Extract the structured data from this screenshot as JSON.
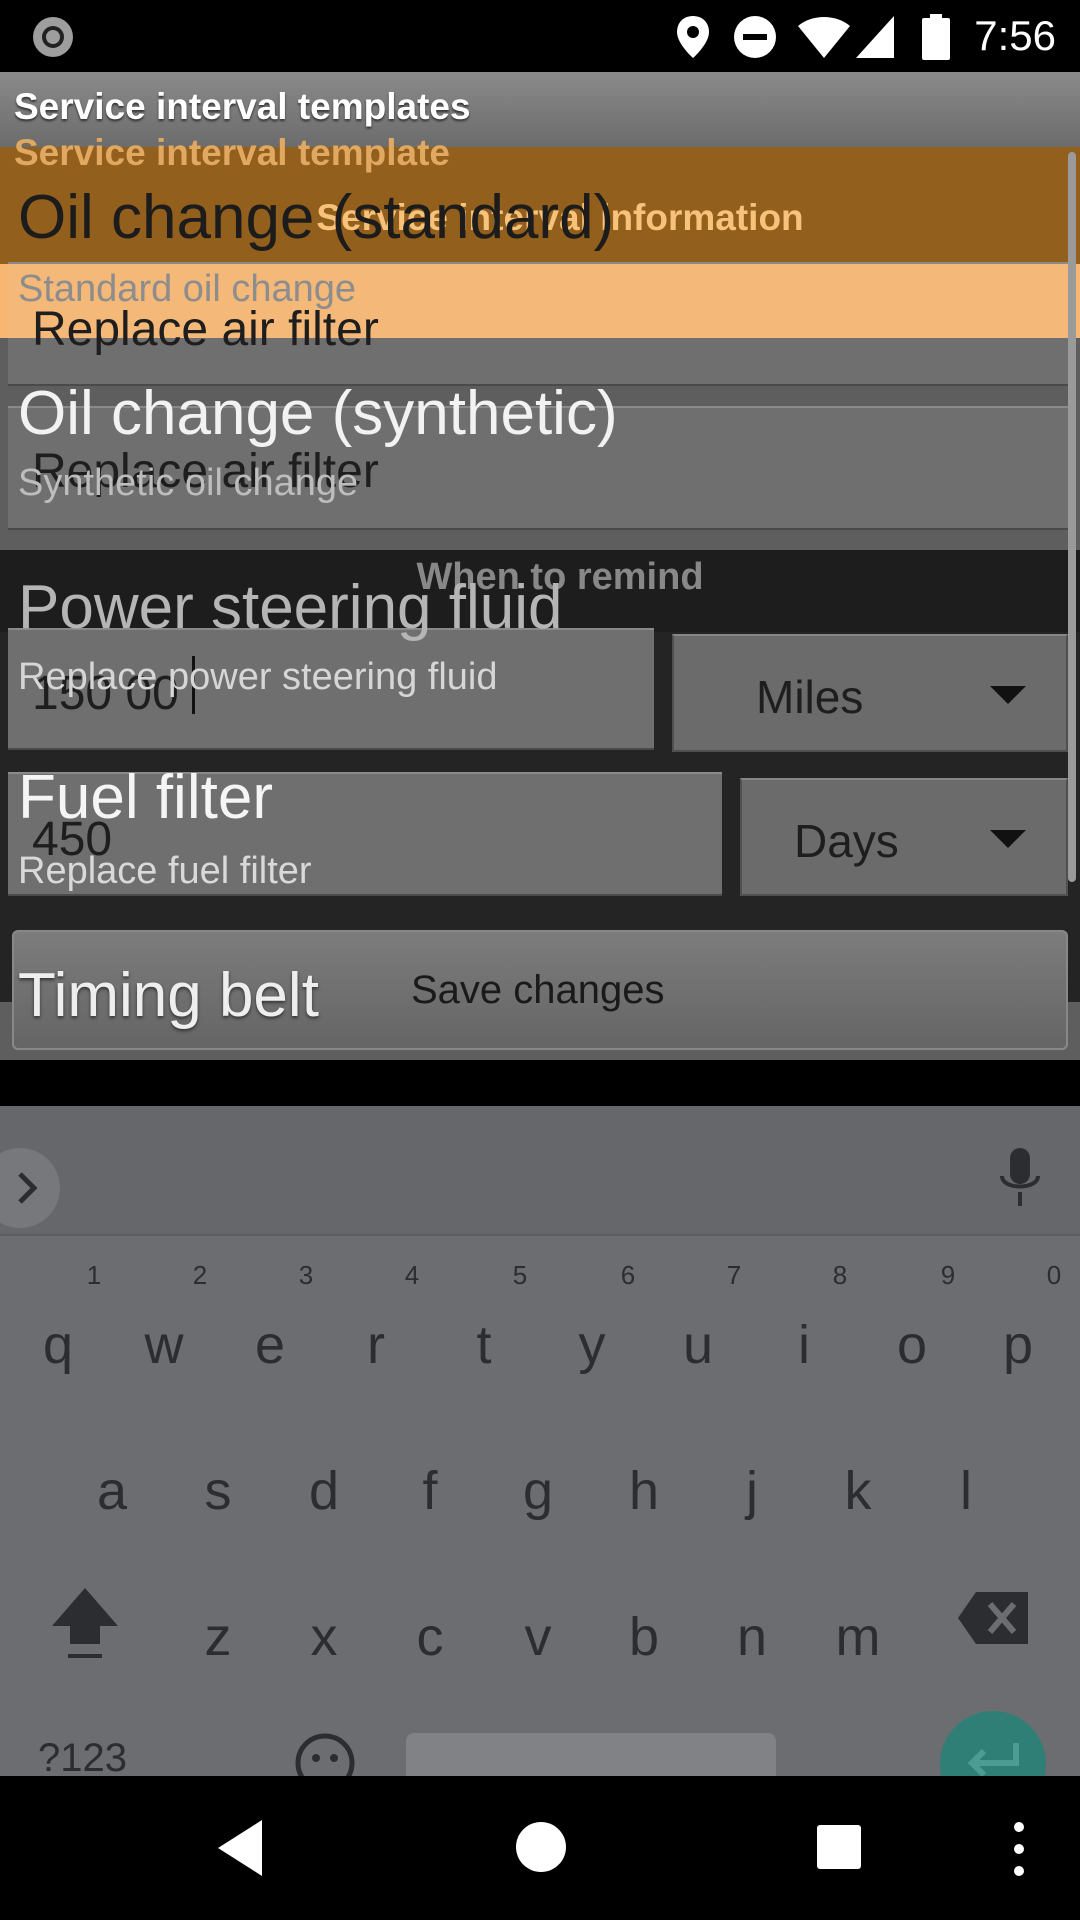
{
  "status_bar": {
    "time": "7:56",
    "icons": [
      "record-icon",
      "location-icon",
      "do-not-disturb-icon",
      "wifi-icon",
      "cell-signal-icon",
      "battery-icon"
    ]
  },
  "app": {
    "title_templates": "Service interval templates",
    "title_template": "Service interval template",
    "info_header": "Service interval information",
    "name_field_1": "Replace air filter",
    "name_field_2": "Replace air filter",
    "when_to_remind": "When to remind",
    "interval_1_value": "150 00",
    "interval_1_unit": "Miles",
    "interval_2_value": "450",
    "interval_2_unit": "Days",
    "save_button": "Save changes"
  },
  "overlay_list": [
    {
      "title": "Oil change (standard)",
      "subtitle": "Standard oil change"
    },
    {
      "title": "Oil change (synthetic)",
      "subtitle": "Synthetic oil change"
    },
    {
      "title": "Power steering fluid",
      "subtitle": "Replace power steering fluid"
    },
    {
      "title": "Fuel filter",
      "subtitle": "Replace fuel filter"
    },
    {
      "title": "Timing belt",
      "subtitle": ""
    }
  ],
  "keyboard": {
    "row1": [
      "q",
      "w",
      "e",
      "r",
      "t",
      "y",
      "u",
      "i",
      "o",
      "p"
    ],
    "row1_hints": [
      "1",
      "2",
      "3",
      "4",
      "5",
      "6",
      "7",
      "8",
      "9",
      "0"
    ],
    "row2": [
      "a",
      "s",
      "d",
      "f",
      "g",
      "h",
      "j",
      "k",
      "l"
    ],
    "row3": [
      "z",
      "x",
      "c",
      "v",
      "b",
      "n",
      "m"
    ],
    "symbols_label": "?123"
  },
  "colors": {
    "header_orange": "#965f19",
    "header_light_orange": "#ffbe78",
    "enter_key": "#2f7f76"
  }
}
